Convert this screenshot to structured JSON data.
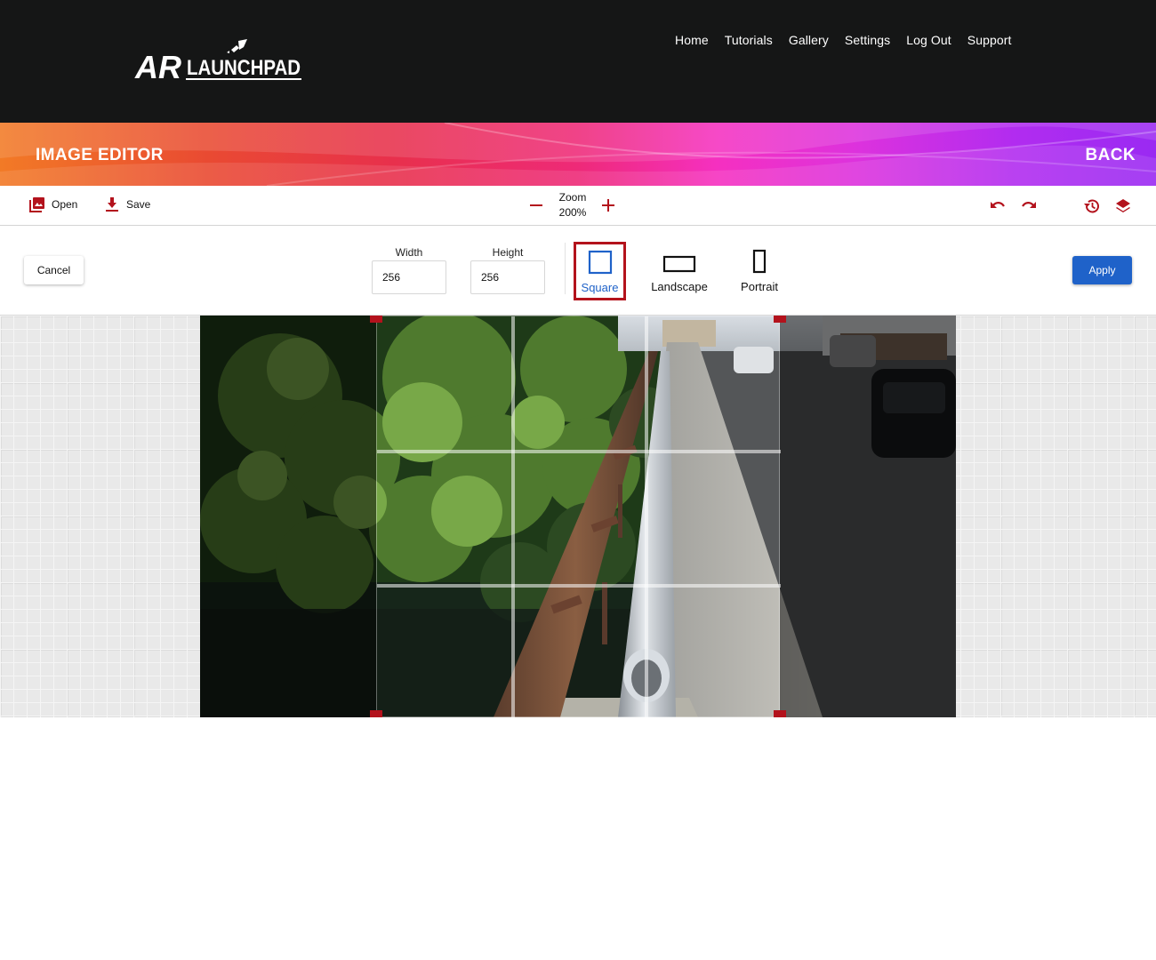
{
  "app": {
    "logo_text": "AR LAUNCHPAD",
    "nav": [
      "Home",
      "Tutorials",
      "Gallery",
      "Settings",
      "Log Out",
      "Support"
    ]
  },
  "banner": {
    "title": "IMAGE EDITOR",
    "back_label": "BACK"
  },
  "toolbar": {
    "open_label": "Open",
    "save_label": "Save",
    "zoom_label": "Zoom",
    "zoom_value": "200%"
  },
  "crop": {
    "cancel_label": "Cancel",
    "width_label": "Width",
    "width_value": "256",
    "height_label": "Height",
    "height_value": "256",
    "shapes": [
      {
        "label": "Square",
        "selected": true
      },
      {
        "label": "Landscape",
        "selected": false
      },
      {
        "label": "Portrait",
        "selected": false
      }
    ],
    "apply_label": "Apply"
  },
  "colors": {
    "accent_red": "#b3121c",
    "primary_blue": "#1f62c9",
    "nav_bg": "#151616"
  }
}
